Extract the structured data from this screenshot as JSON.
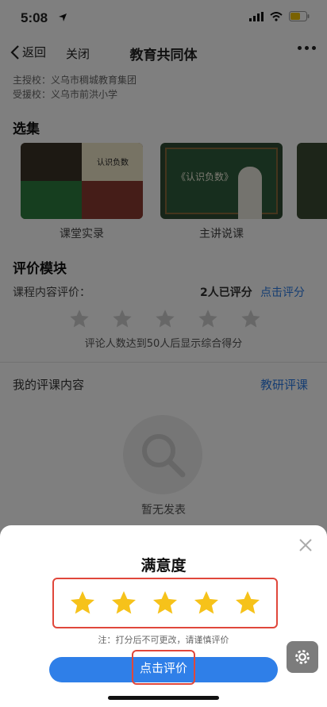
{
  "status": {
    "time": "5:08"
  },
  "nav": {
    "back_label": "返回",
    "close_label": "关闭",
    "title": "教育共同体"
  },
  "school": {
    "line1": "主授校：义乌市稠城教育集团",
    "line2": "受援校：义乌市前洪小学"
  },
  "collection": {
    "title": "选集",
    "items": [
      {
        "label": "课堂实录",
        "thumb_caption": "认识负数"
      },
      {
        "label": "主讲说课",
        "thumb_caption": "《认识负数》"
      }
    ]
  },
  "evaluation": {
    "title": "评价模块",
    "course_label": "课程内容评价：",
    "rated_count": "2人已评分",
    "rate_link": "点击评分",
    "hint": "评论人数达到50人后显示综合得分"
  },
  "my_review": {
    "title": "我的评课内容",
    "link": "教研评课",
    "empty_text": "暂无发表"
  },
  "sheet": {
    "title": "满意度",
    "rating": 5,
    "max_rating": 5,
    "note": "注：打分后不可更改，请谨慎评价",
    "submit_label": "点击评价"
  },
  "colors": {
    "accent": "#2f7fe8",
    "star": "#f6c21a",
    "highlight": "#e0473b"
  }
}
